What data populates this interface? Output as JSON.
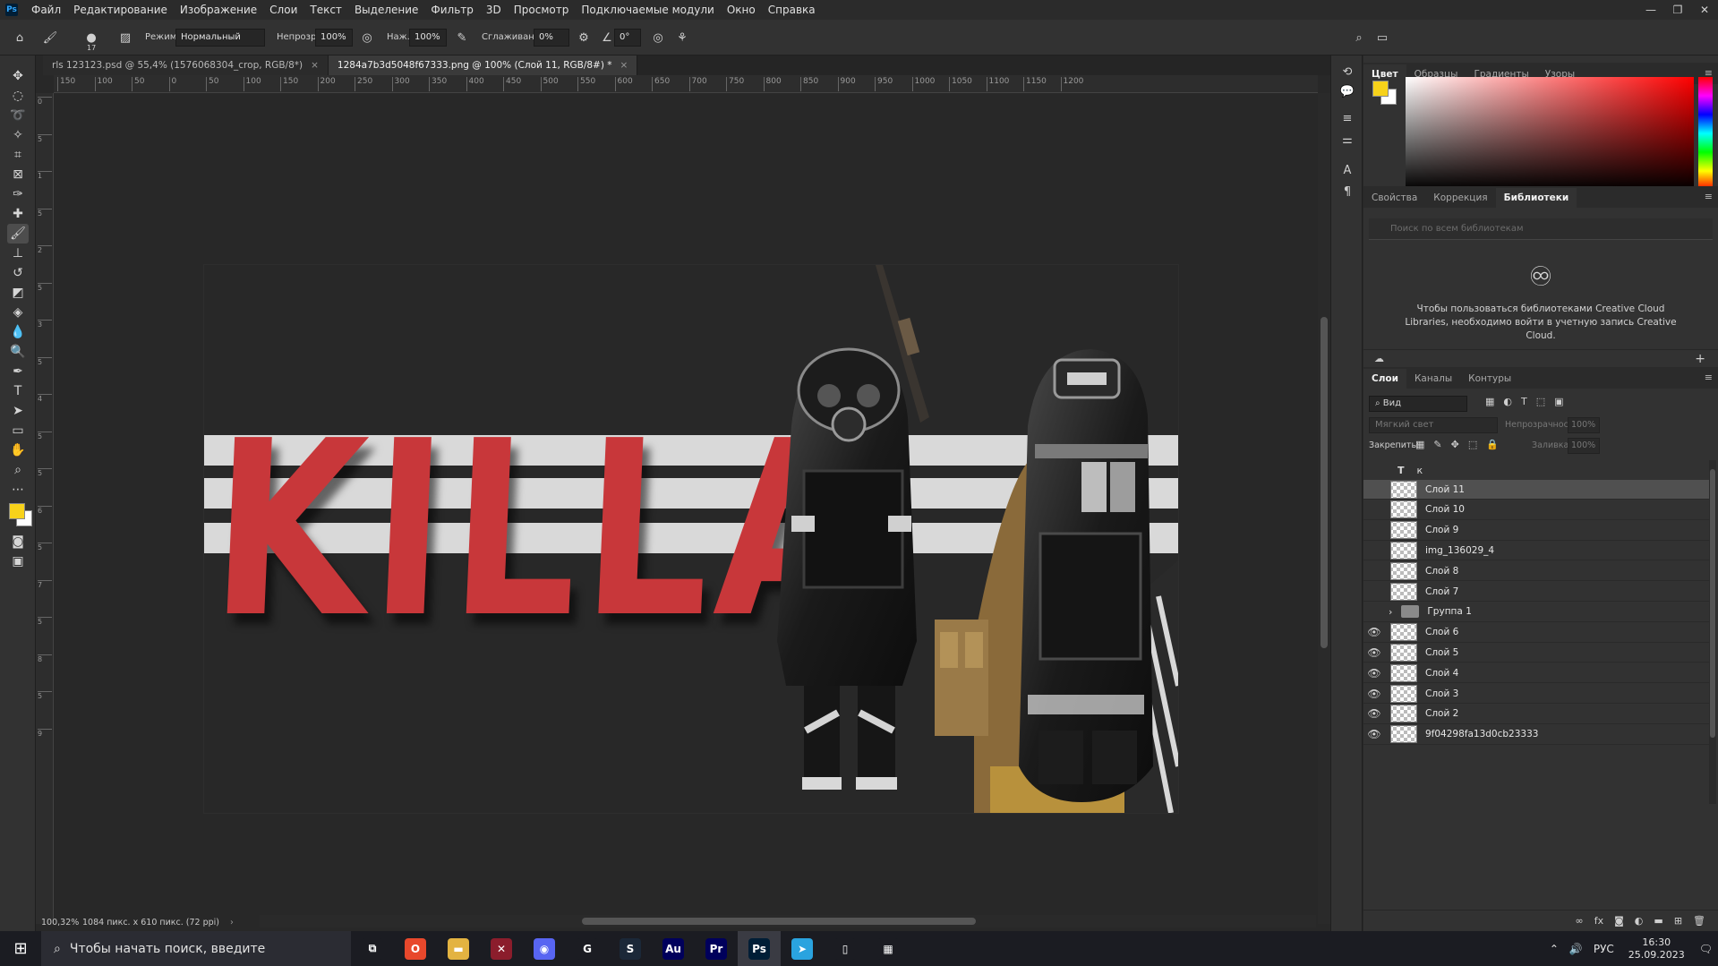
{
  "menu": {
    "app_logo": "Ps",
    "items": [
      "Файл",
      "Редактирование",
      "Изображение",
      "Слои",
      "Текст",
      "Выделение",
      "Фильтр",
      "3D",
      "Просмотр",
      "Подключаемые модули",
      "Окно",
      "Справка"
    ]
  },
  "window_controls": [
    "—",
    "❐",
    "✕"
  ],
  "options": {
    "brush_size": "17",
    "mode_label": "Режим:",
    "mode_value": "Нормальный",
    "opacity_label": "Непрозр.:",
    "opacity_value": "100%",
    "flow_label": "Наж.:",
    "flow_value": "100%",
    "smoothing_label": "Сглаживание:",
    "smoothing_value": "0%",
    "angle_value": "0°"
  },
  "tabs": [
    {
      "label": "rls 123123.psd @ 55,4% (1576068304_crop, RGB/8*)",
      "close": "×"
    },
    {
      "label": "1284a7b3d5048f67333.png @ 100% (Слой 11, RGB/8#) *",
      "close": "×"
    }
  ],
  "ruler_h": [
    "150",
    "100",
    "50",
    "0",
    "50",
    "100",
    "150",
    "200",
    "250",
    "300",
    "350",
    "400",
    "450",
    "500",
    "550",
    "600",
    "650",
    "700",
    "750",
    "800",
    "850",
    "900",
    "950",
    "1000",
    "1050",
    "1100",
    "1150",
    "1200"
  ],
  "ruler_v": [
    "0",
    "5",
    "1",
    "5",
    "2",
    "5",
    "3",
    "5",
    "4",
    "5",
    "5",
    "6",
    "5",
    "7",
    "5",
    "8",
    "5",
    "9"
  ],
  "artwork": {
    "text": "KILLA",
    "text_color": "#c8373a",
    "stripe_color": "#d9d9d9"
  },
  "status": {
    "zoom": "100,32%",
    "doc_size": "1084 пикс. x 610 пикс. (72 ppi)"
  },
  "color_panel": {
    "tabs": [
      "Цвет",
      "Образцы",
      "Градиенты",
      "Узоры"
    ],
    "fg_color": "#f7d21a",
    "bg_color": "#ffffff"
  },
  "props_panel": {
    "tabs": [
      "Свойства",
      "Коррекция",
      "Библиотеки"
    ],
    "search_placeholder": "Поиск по всем библиотекам",
    "message": "Чтобы пользоваться библиотеками Creative Cloud Libraries, необходимо войти в учетную запись Creative Cloud."
  },
  "layers_panel": {
    "tabs": [
      "Слои",
      "Каналы",
      "Контуры"
    ],
    "filter_value": "Вид",
    "blend_mode": "Мягкий свет",
    "opacity_label": "Непрозрачность:",
    "opacity_value": "100%",
    "lock_label": "Закрепить:",
    "fill_label": "Заливка:",
    "fill_value": "100%",
    "text_layer_label": "к",
    "layers": [
      {
        "name": "Слой 11",
        "visible": false,
        "selected": true
      },
      {
        "name": "Слой 10",
        "visible": false
      },
      {
        "name": "Слой 9",
        "visible": false
      },
      {
        "name": "img_136029_4",
        "visible": false
      },
      {
        "name": "Слой 8",
        "visible": false
      },
      {
        "name": "Слой 7",
        "visible": false
      },
      {
        "name": "Группа 1",
        "visible": false,
        "group": true
      },
      {
        "name": "Слой 6",
        "visible": true
      },
      {
        "name": "Слой 5",
        "visible": true
      },
      {
        "name": "Слой 4",
        "visible": true
      },
      {
        "name": "Слой 3",
        "visible": true
      },
      {
        "name": "Слой 2",
        "visible": true
      },
      {
        "name": "9f04298fa13d0cb23333",
        "visible": true
      }
    ]
  },
  "taskbar": {
    "search_text": "Чтобы начать поиск, введите",
    "apps": [
      {
        "name": "task-view",
        "label": "⧉",
        "color": "#1b1c22"
      },
      {
        "name": "opera",
        "label": "O",
        "color": "#e8482c"
      },
      {
        "name": "explorer",
        "label": "▬",
        "color": "#e3b341"
      },
      {
        "name": "app-x",
        "label": "✕",
        "color": "#8b1d2c"
      },
      {
        "name": "discord",
        "label": "◉",
        "color": "#5865f2"
      },
      {
        "name": "app-g",
        "label": "G",
        "color": "#1b1c22"
      },
      {
        "name": "steam",
        "label": "S",
        "color": "#1b2838"
      },
      {
        "name": "audition",
        "label": "Au",
        "color": "#00005b"
      },
      {
        "name": "premiere",
        "label": "Pr",
        "color": "#00005b"
      },
      {
        "name": "photoshop",
        "label": "Ps",
        "color": "#001e36"
      },
      {
        "name": "telegram",
        "label": "➤",
        "color": "#2aa3df"
      },
      {
        "name": "notepad",
        "label": "▯",
        "color": "#1b1c22"
      },
      {
        "name": "calculator",
        "label": "▦",
        "color": "#1b1c22"
      }
    ],
    "lang": "РУС",
    "time": "16:30",
    "date": "25.09.2023"
  }
}
